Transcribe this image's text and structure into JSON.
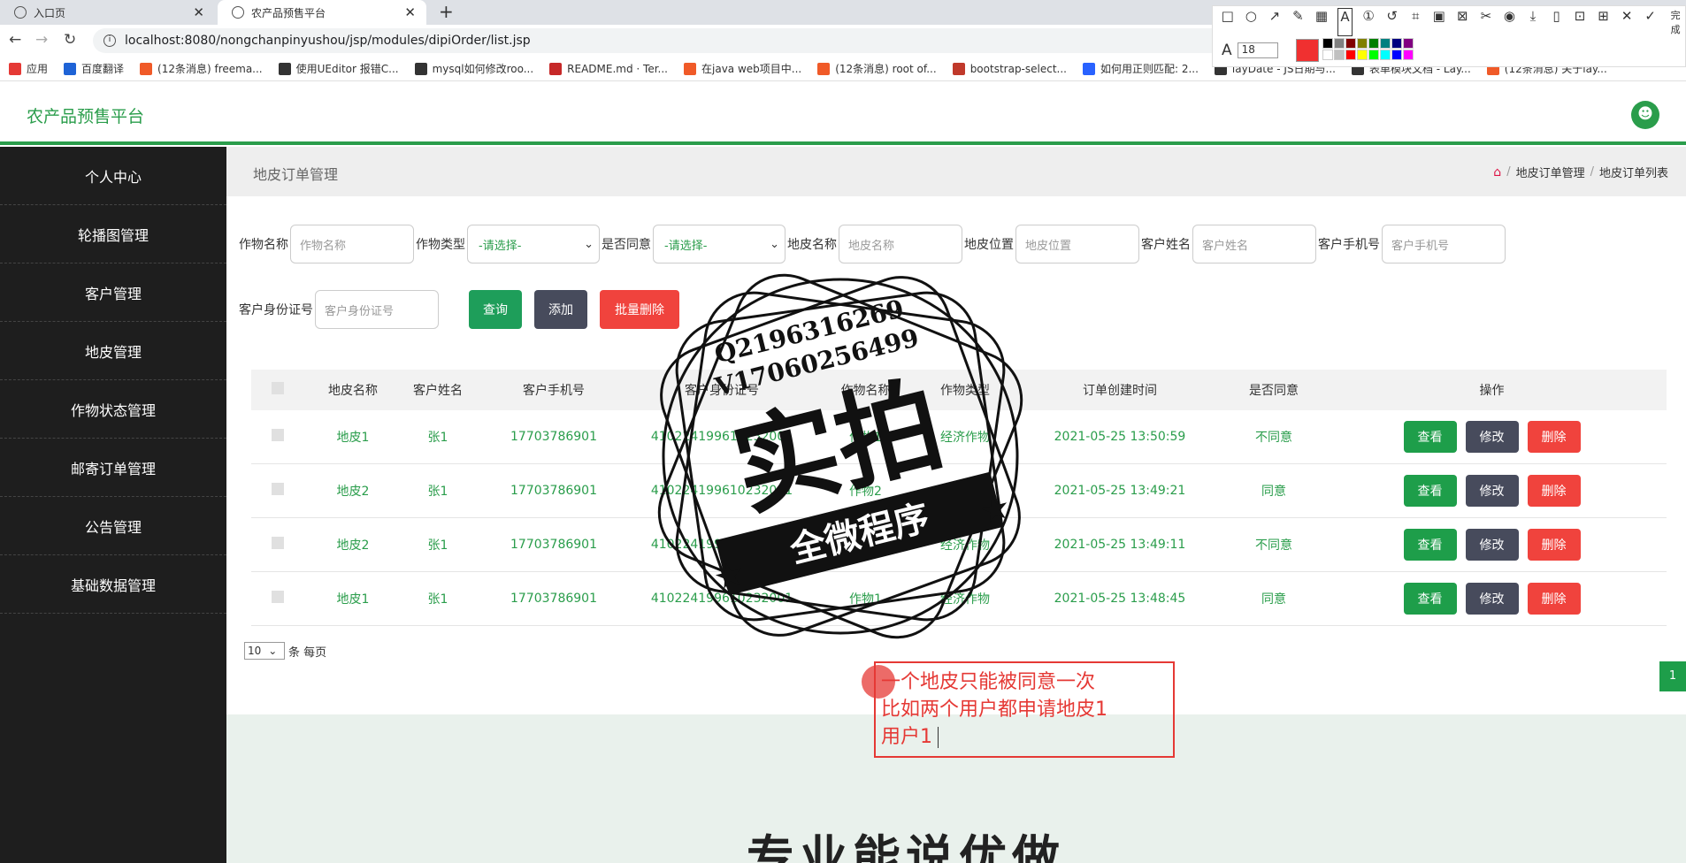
{
  "browser": {
    "tabs": [
      {
        "label": "入口页"
      },
      {
        "label": "农产品预售平台"
      }
    ],
    "url": "localhost:8080/nongchanpinyushou/jsp/modules/dipiOrder/list.jsp",
    "bookmarks": [
      {
        "label": "应用",
        "color": "#e53935"
      },
      {
        "label": "百度翻译",
        "color": "#1e63d6"
      },
      {
        "label": "(12条消息) freema...",
        "color": "#f05a28"
      },
      {
        "label": "使用UEditor 报错C...",
        "color": "#333333"
      },
      {
        "label": "mysql如何修改roo...",
        "color": "#333333"
      },
      {
        "label": "README.md · Ter...",
        "color": "#c62828"
      },
      {
        "label": "在java web项目中...",
        "color": "#f05a28"
      },
      {
        "label": "(12条消息) root of...",
        "color": "#f05a28"
      },
      {
        "label": "bootstrap-select...",
        "color": "#c0392b"
      },
      {
        "label": "如何用正则匹配: 2...",
        "color": "#2962ff"
      },
      {
        "label": "layDate - JS日期与...",
        "color": "#333333"
      },
      {
        "label": "表单模块文档 - Lay...",
        "color": "#333333"
      },
      {
        "label": "(12条消息) 关于lay...",
        "color": "#f05a28"
      }
    ]
  },
  "screenshot_tool": {
    "font_size": "18",
    "current_color": "#f03030",
    "finish_label": "完成",
    "palette": [
      "#000000",
      "#808080",
      "#800000",
      "#808000",
      "#008000",
      "#008080",
      "#000080",
      "#800080",
      "#ffffff",
      "#c0c0c0",
      "#ff0000",
      "#ffff00",
      "#00ff00",
      "#00ffff",
      "#0000ff",
      "#ff00ff"
    ]
  },
  "app": {
    "logo": "农产品预售平台",
    "accent": "#2a9d4b"
  },
  "sidebar": {
    "items": [
      "个人中心",
      "轮播图管理",
      "客户管理",
      "地皮管理",
      "作物状态管理",
      "邮寄订单管理",
      "公告管理",
      "基础数据管理"
    ]
  },
  "page": {
    "title": "地皮订单管理",
    "breadcrumbs": [
      "地皮订单管理",
      "地皮订单列表"
    ]
  },
  "filters": {
    "crop_name_label": "作物名称",
    "crop_name_placeholder": "作物名称",
    "crop_type_label": "作物类型",
    "crop_type_value": "-请选择-",
    "agree_label": "是否同意",
    "agree_value": "-请选择-",
    "land_name_label": "地皮名称",
    "land_name_placeholder": "地皮名称",
    "land_loc_label": "地皮位置",
    "land_loc_placeholder": "地皮位置",
    "cust_name_label": "客户姓名",
    "cust_name_placeholder": "客户姓名",
    "cust_phone_label": "客户手机号",
    "cust_phone_placeholder": "客户手机号",
    "cust_id_label": "客户身份证号",
    "cust_id_placeholder": "客户身份证号",
    "search_btn": "查询",
    "add_btn": "添加",
    "batch_delete_btn": "批量删除"
  },
  "table": {
    "headers": [
      "地皮名称",
      "客户姓名",
      "客户手机号",
      "客户身份证号",
      "作物名称",
      "作物类型",
      "订单创建时间",
      "是否同意",
      "操作"
    ],
    "rows": [
      {
        "land": "地皮1",
        "name": "张1",
        "phone": "17703786901",
        "idcard": "410224199610232001",
        "crop": "作物1",
        "type": "经济作物",
        "time": "2021-05-25 13:50:59",
        "agree": "不同意"
      },
      {
        "land": "地皮2",
        "name": "张1",
        "phone": "17703786901",
        "idcard": "410224199610232001",
        "crop": "作物2",
        "type": "经济作物",
        "time": "2021-05-25 13:49:21",
        "agree": "同意"
      },
      {
        "land": "地皮2",
        "name": "张1",
        "phone": "17703786901",
        "idcard": "410224199610232001",
        "crop": "作物1",
        "type": "经济作物",
        "time": "2021-05-25 13:49:11",
        "agree": "不同意"
      },
      {
        "land": "地皮1",
        "name": "张1",
        "phone": "17703786901",
        "idcard": "410224199610232001",
        "crop": "作物1",
        "type": "经济作物",
        "time": "2021-05-25 13:48:45",
        "agree": "同意"
      }
    ],
    "actions": {
      "view": "查看",
      "edit": "修改",
      "delete": "删除"
    }
  },
  "pagination": {
    "page_size": "10",
    "per_page_text": "条 每页",
    "current_page": "1"
  },
  "footer": {
    "slogan": "专业能说优做"
  },
  "annotation": {
    "lines": [
      "一个地皮只能被同意一次",
      "比如两个用户都申请地皮1",
      "用户1"
    ]
  },
  "watermark": {
    "line1": "Q2196316269",
    "line2": "V17060256499",
    "big": "实拍",
    "banner": "全微程序"
  }
}
